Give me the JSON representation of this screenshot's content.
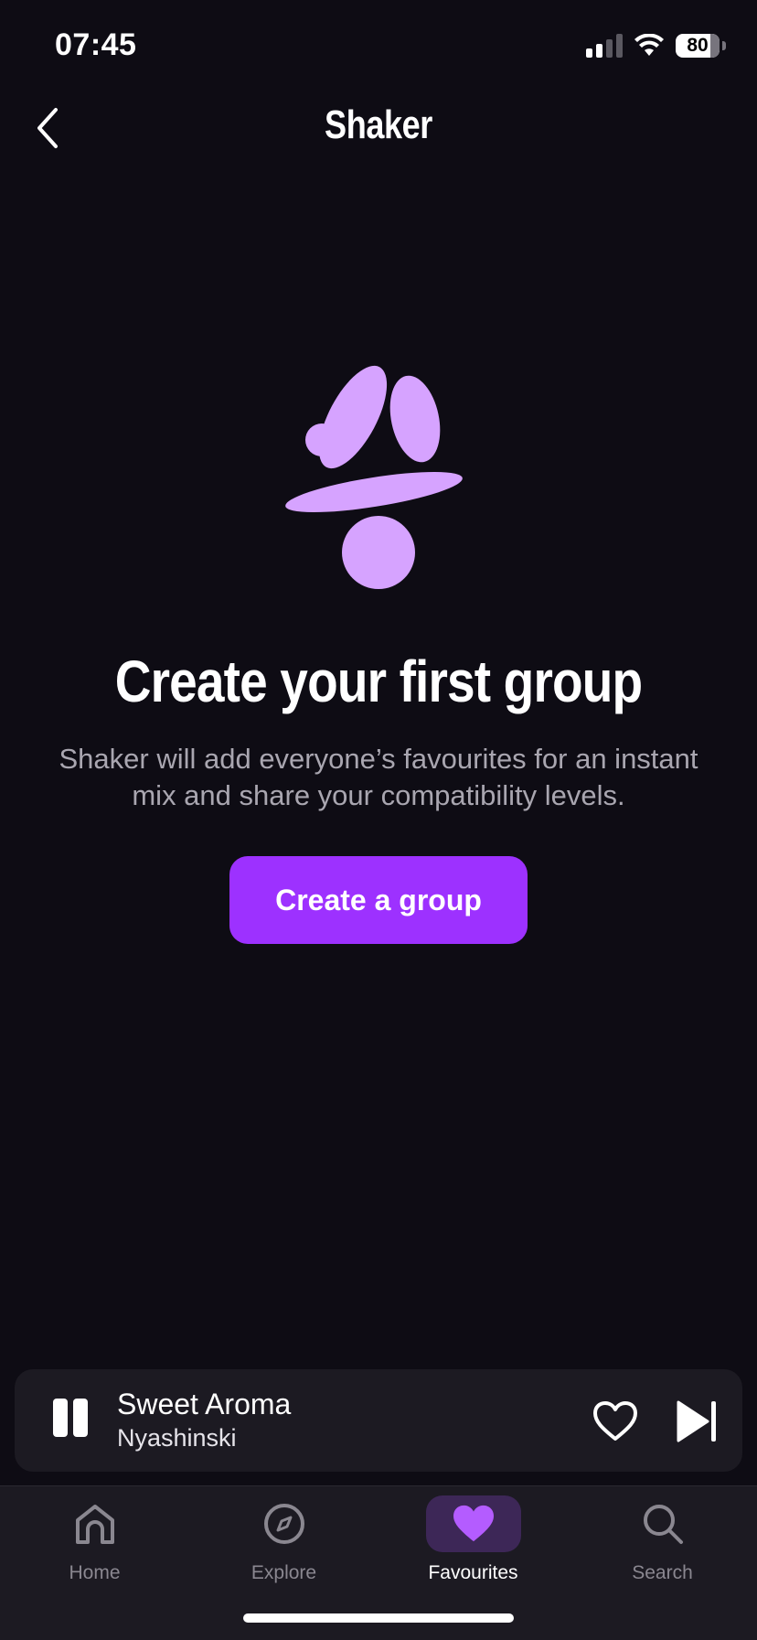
{
  "status_bar": {
    "time": "07:45",
    "battery": "80"
  },
  "header": {
    "title": "Shaker"
  },
  "empty_state": {
    "title": "Create your first group",
    "description": "Shaker will add everyone’s favourites for an instant mix and share your compatibility levels.",
    "button_label": "Create a group"
  },
  "mini_player": {
    "track_title": "Sweet Aroma",
    "artist": "Nyashinski"
  },
  "tabs": [
    {
      "label": "Home",
      "icon": "home-icon",
      "active": false
    },
    {
      "label": "Explore",
      "icon": "compass-icon",
      "active": false
    },
    {
      "label": "Favourites",
      "icon": "heart-icon",
      "active": true
    },
    {
      "label": "Search",
      "icon": "search-icon",
      "active": false
    }
  ],
  "colors": {
    "background": "#0e0c14",
    "accent": "#9d31ff",
    "illustration": "#d6a3ff",
    "active_tab_bg": "#3d2757"
  }
}
